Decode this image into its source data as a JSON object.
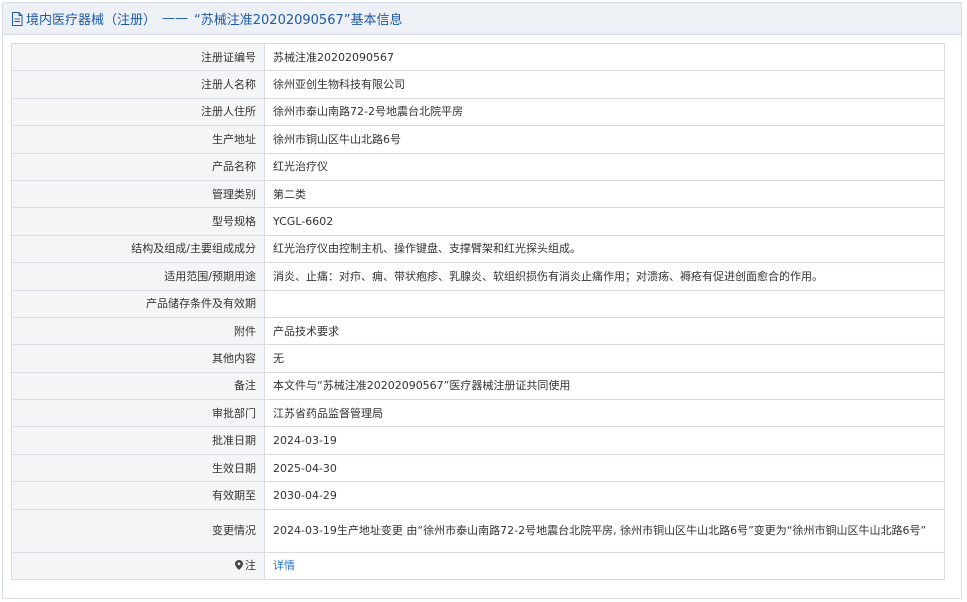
{
  "header": {
    "prefix": "境内医疗器械（注册）",
    "separator": "——",
    "title": "“苏械注准20202090567”基本信息"
  },
  "rows": [
    {
      "label": "注册证编号",
      "value": "苏械注准20202090567"
    },
    {
      "label": "注册人名称",
      "value": "徐州亚创生物科技有限公司"
    },
    {
      "label": "注册人住所",
      "value": "徐州市泰山南路72-2号地震台北院平房"
    },
    {
      "label": "生产地址",
      "value": "徐州市铜山区牛山北路6号"
    },
    {
      "label": "产品名称",
      "value": "红光治疗仪"
    },
    {
      "label": "管理类别",
      "value": "第二类"
    },
    {
      "label": "型号规格",
      "value": "YCGL-6602"
    },
    {
      "label": "结构及组成/主要组成成分",
      "value": "红光治疗仪由控制主机、操作键盘、支撑臂架和红光探头组成。"
    },
    {
      "label": "适用范围/预期用途",
      "value": "消炎、止痛：对疖、痈、带状疱疹、乳腺炎、软组织损伤有消炎止痛作用；对溃疡、褥疮有促进创面愈合的作用。"
    },
    {
      "label": "产品储存条件及有效期",
      "value": ""
    },
    {
      "label": "附件",
      "value": "产品技术要求"
    },
    {
      "label": "其他内容",
      "value": "无"
    },
    {
      "label": "备注",
      "value": "本文件与“苏械注准20202090567”医疗器械注册证共同使用"
    },
    {
      "label": "审批部门",
      "value": "江苏省药品监督管理局"
    },
    {
      "label": "批准日期",
      "value": "2024-03-19"
    },
    {
      "label": "生效日期",
      "value": "2025-04-30"
    },
    {
      "label": "有效期至",
      "value": "2030-04-29"
    },
    {
      "label": "变更情况",
      "value": "2024-03-19生产地址变更 由“徐州市泰山南路72-2号地震台北院平房, 徐州市铜山区牛山北路6号”变更为“徐州市铜山区牛山北路6号”"
    }
  ],
  "note": {
    "label": "注",
    "icon": "location-pin-icon",
    "link_text": "详情"
  },
  "colors": {
    "accent": "#1e5aa8",
    "link": "#2a74c9",
    "label_bg": "#f4f5f7",
    "header_bg": "#edf1f6",
    "border": "#d9dde3"
  }
}
